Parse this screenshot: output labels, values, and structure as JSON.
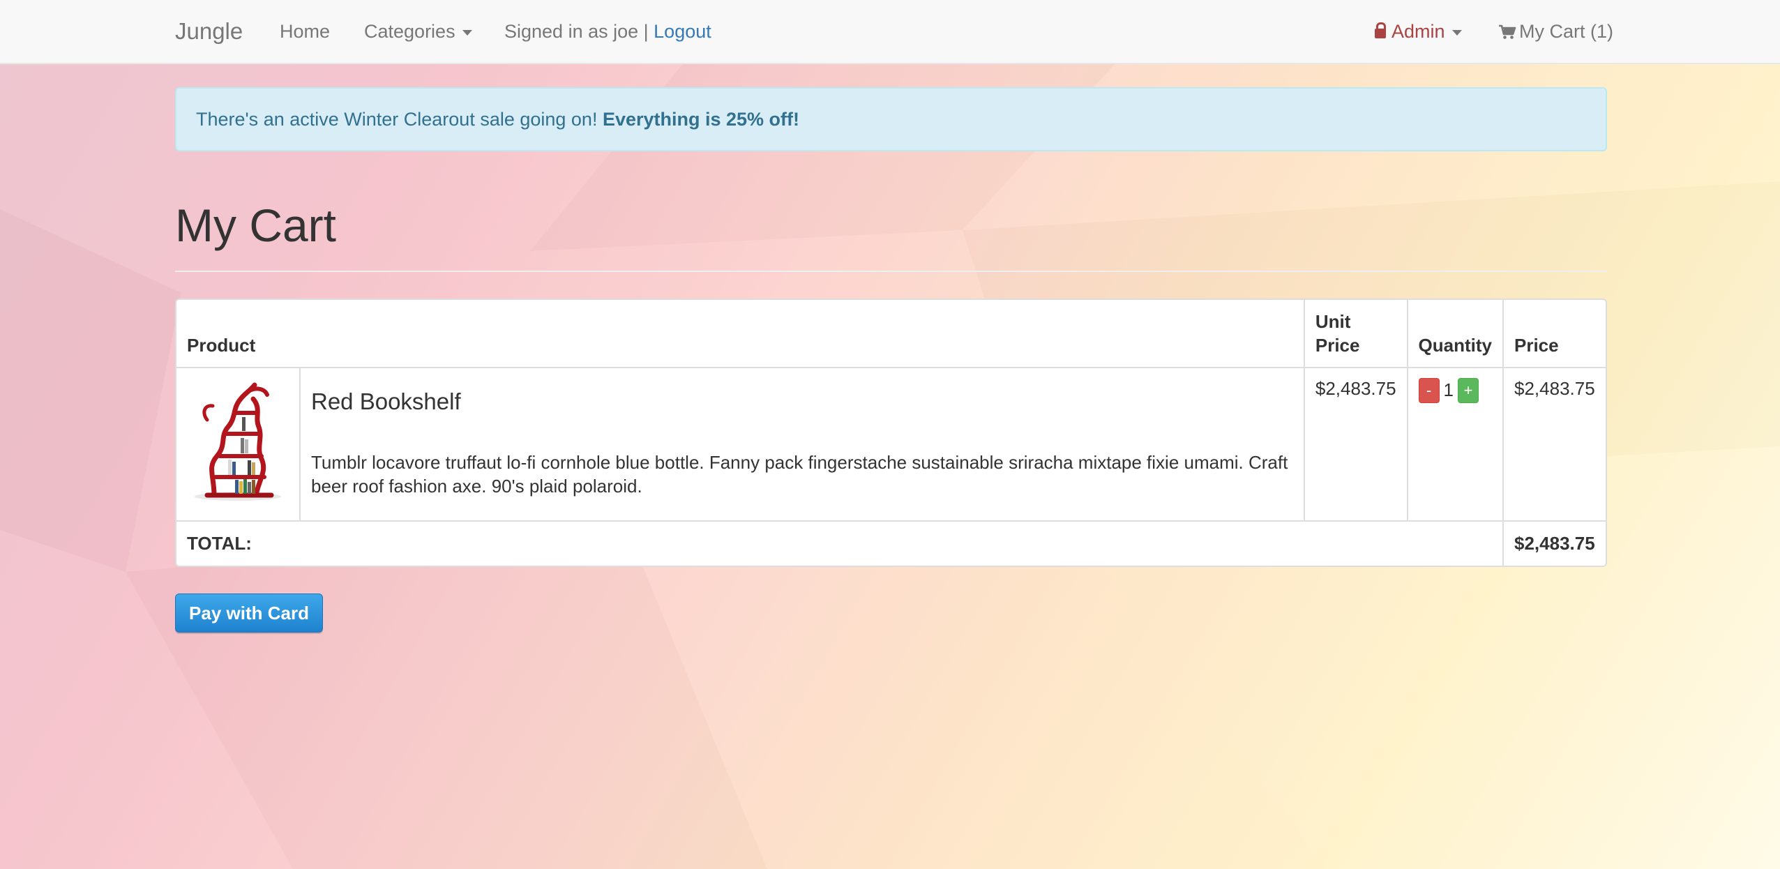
{
  "navbar": {
    "brand": "Jungle",
    "home": "Home",
    "categories": "Categories",
    "signed_in_text": "Signed in as joe | ",
    "logout": "Logout",
    "admin": "Admin",
    "cart": "My Cart (1)"
  },
  "alert": {
    "text": "There's an active Winter Clearout sale going on! ",
    "emphasis": "Everything is 25% off!"
  },
  "page": {
    "title": "My Cart"
  },
  "table": {
    "headers": {
      "product": "Product",
      "unit_price": "Unit Price",
      "quantity": "Quantity",
      "price": "Price"
    },
    "rows": [
      {
        "image_icon": "red-bookshelf-image",
        "name": "Red Bookshelf",
        "description": "Tumblr locavore truffaut lo-fi cornhole blue bottle. Fanny pack fingerstache sustainable sriracha mixtape fixie umami. Craft beer roof fashion axe. 90's plaid polaroid.",
        "unit_price": "$2,483.75",
        "quantity": "1",
        "minus_label": "-",
        "plus_label": "+",
        "price": "$2,483.75"
      }
    ],
    "total_label": "TOTAL:",
    "total_value": "$2,483.75"
  },
  "pay_button": "Pay with Card",
  "colors": {
    "link": "#337ab7",
    "admin": "#a94442",
    "alert_bg": "#d9edf7",
    "alert_text": "#31708f",
    "minus_button": "#d9534f",
    "plus_button": "#5cb85c",
    "pay_button": "#2a93dd"
  }
}
